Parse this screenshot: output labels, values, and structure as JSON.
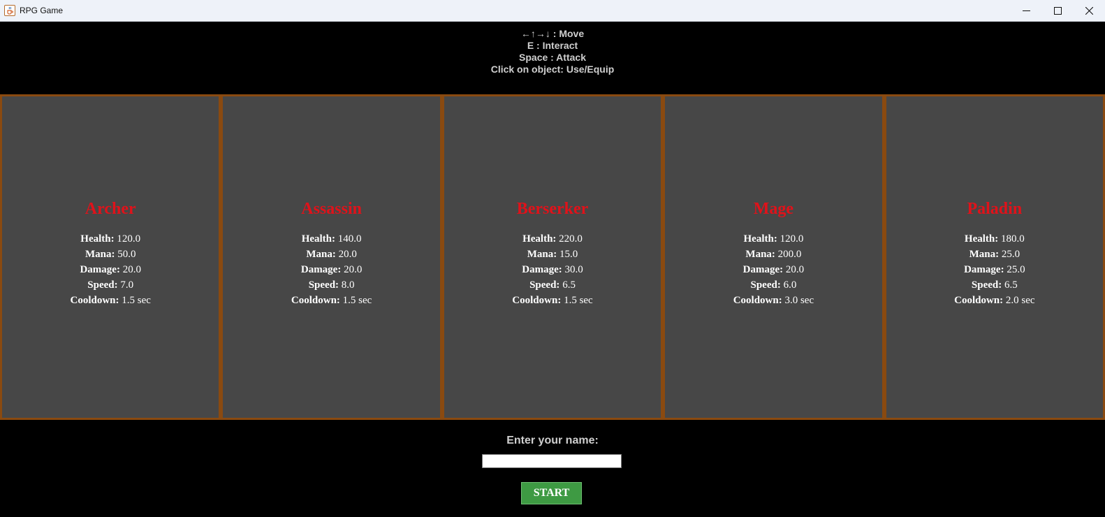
{
  "window": {
    "title": "RPG Game",
    "app_icon": "java-cup-icon",
    "controls": [
      "minimize-icon",
      "maximize-icon",
      "close-icon"
    ]
  },
  "instructions": [
    "←↑→↓ : Move",
    "E : Interact",
    "Space : Attack",
    "Click on object: Use/Equip"
  ],
  "stat_labels": {
    "health": "Health:",
    "mana": "Mana:",
    "damage": "Damage:",
    "speed": "Speed:",
    "cooldown": "Cooldown:"
  },
  "classes": [
    {
      "name": "Archer",
      "health": "120.0",
      "mana": "50.0",
      "damage": "20.0",
      "speed": "7.0",
      "cooldown": "1.5 sec"
    },
    {
      "name": "Assassin",
      "health": "140.0",
      "mana": "20.0",
      "damage": "20.0",
      "speed": "8.0",
      "cooldown": "1.5 sec"
    },
    {
      "name": "Berserker",
      "health": "220.0",
      "mana": "15.0",
      "damage": "30.0",
      "speed": "6.5",
      "cooldown": "1.5 sec"
    },
    {
      "name": "Mage",
      "health": "120.0",
      "mana": "200.0",
      "damage": "20.0",
      "speed": "6.0",
      "cooldown": "3.0 sec"
    },
    {
      "name": "Paladin",
      "health": "180.0",
      "mana": "25.0",
      "damage": "25.0",
      "speed": "6.5",
      "cooldown": "2.0 sec"
    }
  ],
  "name_entry": {
    "label": "Enter your name:",
    "value": "",
    "placeholder": ""
  },
  "start_button": {
    "label": "START"
  },
  "colors": {
    "background": "#000000",
    "panel": "#474747",
    "panel_border": "#8a4a10",
    "class_name": "#e0121a",
    "start_button": "#3e9a43"
  }
}
